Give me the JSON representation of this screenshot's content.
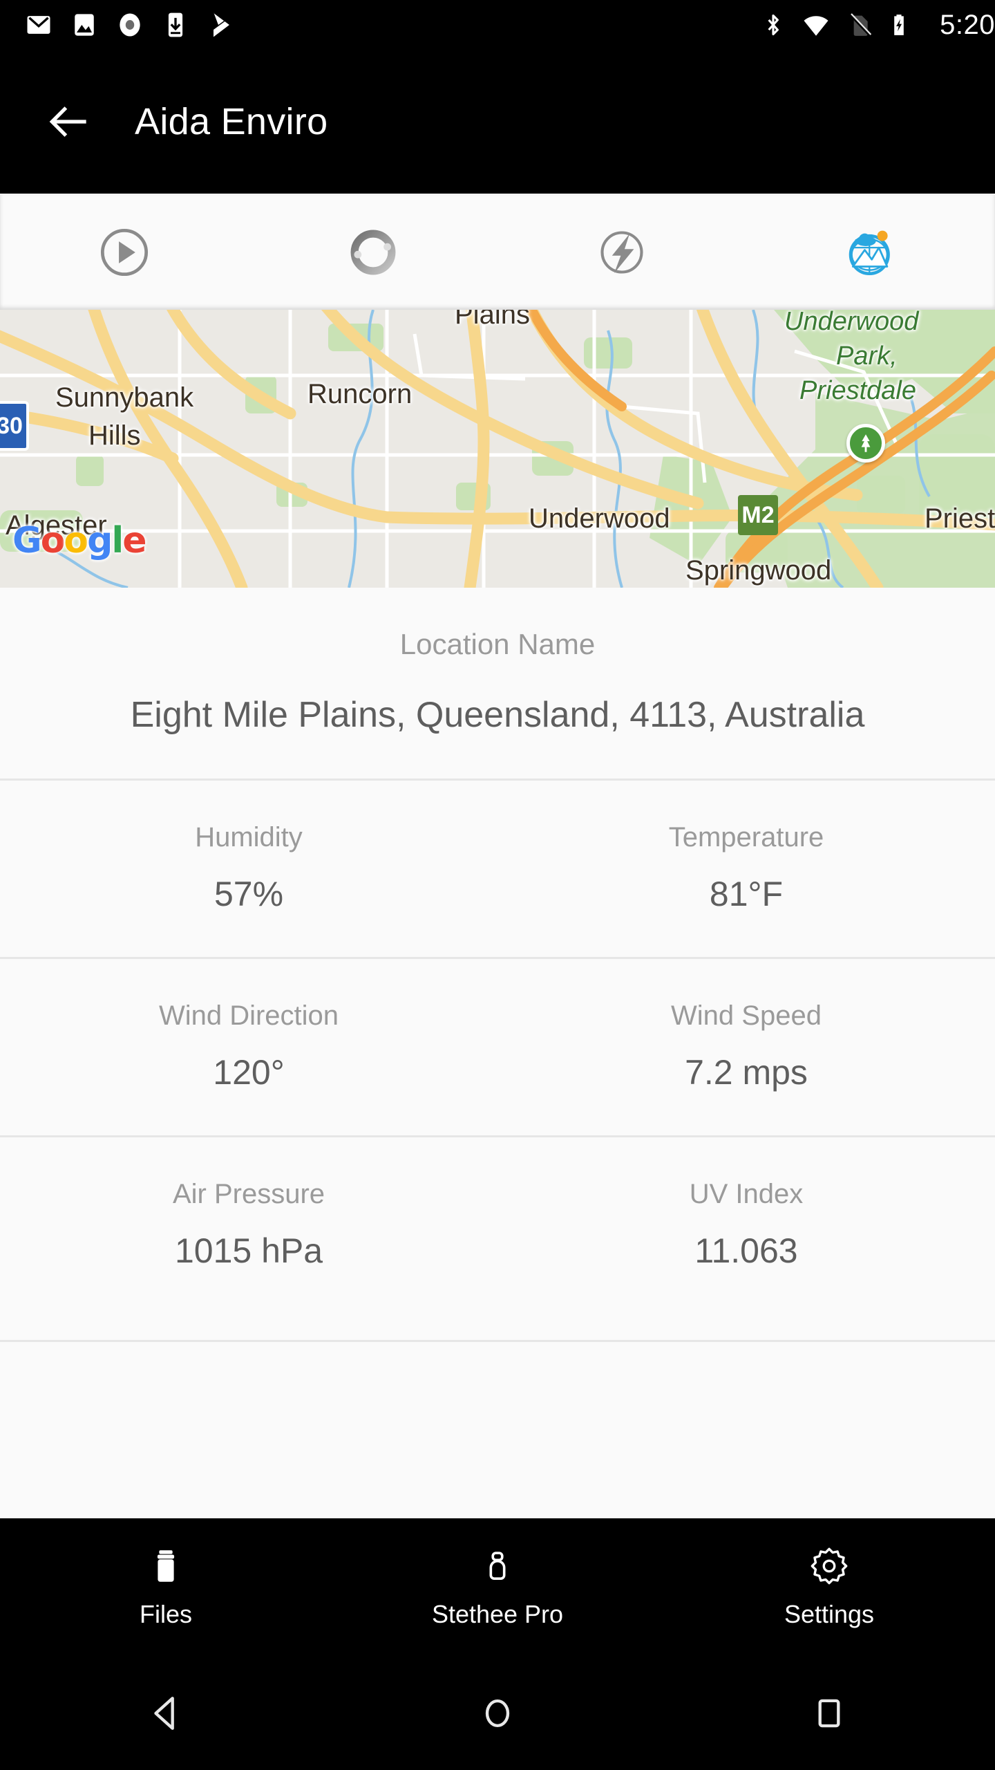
{
  "status_bar": {
    "time": "5:20",
    "left_icons": [
      "gmail-icon",
      "photos-icon",
      "record-icon",
      "download-to-phone-icon",
      "play-store-icon"
    ],
    "right_icons": [
      "bluetooth-icon",
      "wifi-icon",
      "no-sim-icon",
      "battery-charging-icon"
    ]
  },
  "app_bar": {
    "back_icon": "back-arrow-icon",
    "title": "Aida Enviro"
  },
  "tabs": [
    {
      "icon": "play-circle-icon",
      "active": false
    },
    {
      "icon": "sync-circle-icon",
      "active": false
    },
    {
      "icon": "bolt-circle-icon",
      "active": false
    },
    {
      "icon": "environment-globe-icon",
      "active": true
    }
  ],
  "map": {
    "provider_logo": [
      "G",
      "o",
      "o",
      "g",
      "l",
      "e"
    ],
    "labels": [
      {
        "text": "Sunnybank Hills",
        "kind": "place"
      },
      {
        "text": "Runcorn",
        "kind": "place"
      },
      {
        "text": "Algester",
        "kind": "place"
      },
      {
        "text": "Plains",
        "kind": "place"
      },
      {
        "text": "Underwood",
        "kind": "place"
      },
      {
        "text": "Springwood",
        "kind": "place"
      },
      {
        "text": "Priest",
        "kind": "place"
      },
      {
        "text": "Underwood Park, Priestdale",
        "kind": "park"
      }
    ],
    "shields": [
      {
        "text": "M2",
        "kind": "motorway"
      },
      {
        "text": "30",
        "kind": "route"
      }
    ],
    "markers": [
      {
        "icon": "park-tree-icon"
      }
    ],
    "colors": {
      "land": "#ebe9e4",
      "green": "#c9e2b5",
      "road": "#f7d78c",
      "highway": "#f4a94a",
      "water": "#8fc4e8"
    }
  },
  "location": {
    "label": "Location Name",
    "value": "Eight Mile Plains, Queensland, 4113, Australia"
  },
  "metrics": [
    [
      {
        "label": "Humidity",
        "value": "57%"
      },
      {
        "label": "Temperature",
        "value": "81°F"
      }
    ],
    [
      {
        "label": "Wind Direction",
        "value": "120°"
      },
      {
        "label": "Wind Speed",
        "value": "7.2 mps"
      }
    ],
    [
      {
        "label": "Air Pressure",
        "value": "1015 hPa"
      },
      {
        "label": "UV Index",
        "value": "11.063"
      }
    ]
  ],
  "bottom_nav": [
    {
      "label": "Files",
      "icon": "files-icon"
    },
    {
      "label": "Stethee Pro",
      "icon": "stethee-device-icon"
    },
    {
      "label": "Settings",
      "icon": "gear-icon"
    }
  ],
  "android_nav": [
    {
      "icon": "nav-back-icon"
    },
    {
      "icon": "nav-home-icon"
    },
    {
      "icon": "nav-recents-icon"
    }
  ],
  "colors": {
    "accent": "#29a7e0",
    "accent_sun": "#f5a623",
    "bar_background": "#000000",
    "page_background": "#fafafa",
    "label_text": "#9a9a9a",
    "value_text": "#5e5e5e",
    "divider": "#e6e6e6"
  }
}
